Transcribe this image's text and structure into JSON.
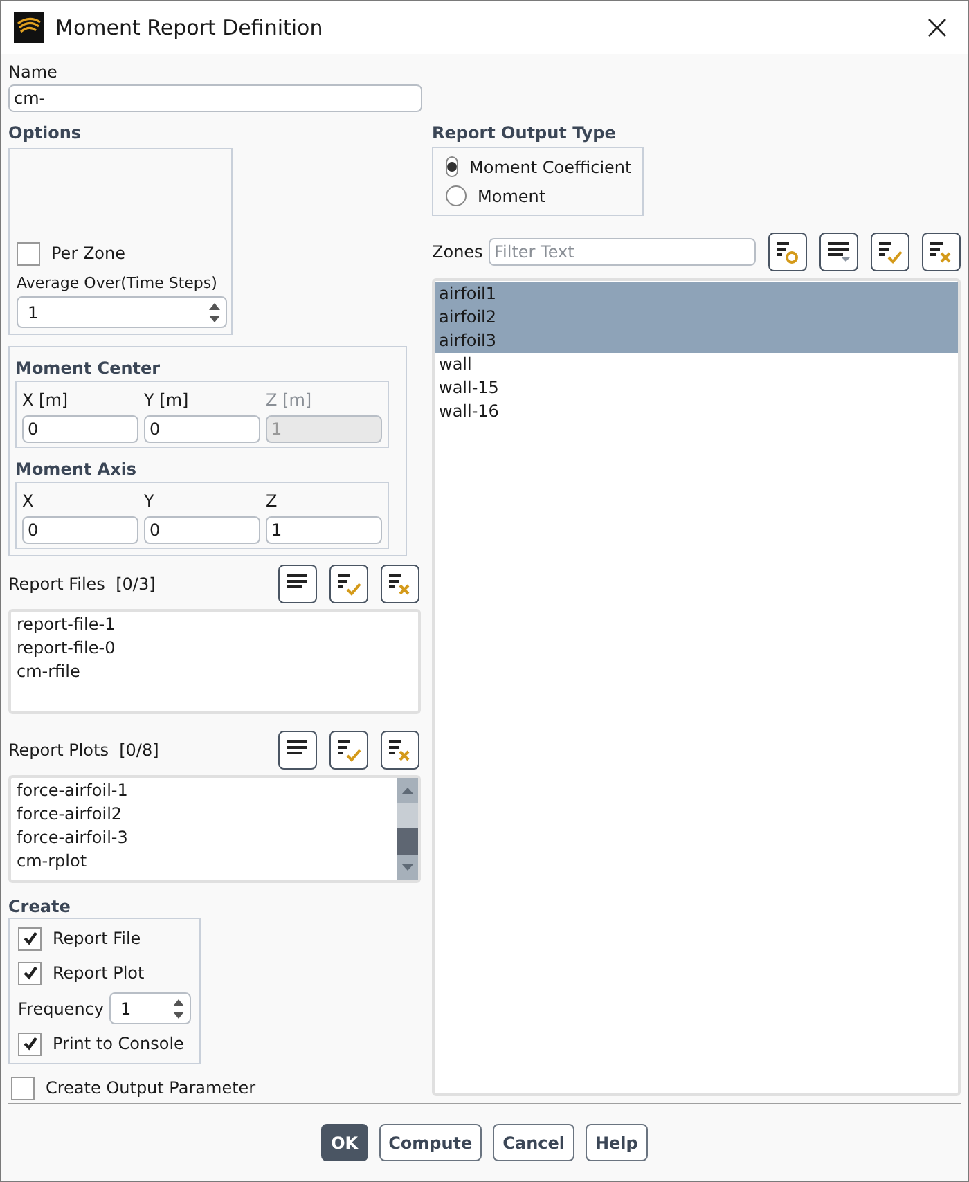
{
  "window": {
    "title": "Moment Report Definition"
  },
  "name": {
    "label": "Name",
    "value": "cm-"
  },
  "options": {
    "title": "Options",
    "per_zone": {
      "label": "Per Zone",
      "checked": false
    },
    "average_over": {
      "label": "Average Over(Time Steps)",
      "value": "1"
    }
  },
  "moment_center": {
    "title": "Moment Center",
    "fields": [
      {
        "label": "X [m]",
        "value": "0",
        "disabled": false
      },
      {
        "label": "Y [m]",
        "value": "0",
        "disabled": false
      },
      {
        "label": "Z [m]",
        "value": "1",
        "disabled": true
      }
    ]
  },
  "moment_axis": {
    "title": "Moment Axis",
    "fields": [
      {
        "label": "X",
        "value": "0",
        "disabled": false
      },
      {
        "label": "Y",
        "value": "0",
        "disabled": false
      },
      {
        "label": "Z",
        "value": "1",
        "disabled": false
      }
    ]
  },
  "report_files": {
    "label": "Report Files",
    "count": "[0/3]",
    "items": [
      "report-file-1",
      "report-file-0",
      "cm-rfile"
    ]
  },
  "report_plots": {
    "label": "Report Plots",
    "count": "[0/8]",
    "items": [
      "force-airfoil-1",
      "force-airfoil2",
      "force-airfoil-3",
      "cm-rplot"
    ]
  },
  "create": {
    "title": "Create",
    "items": [
      {
        "kind": "checkbox",
        "label": "Report File",
        "checked": true
      },
      {
        "kind": "checkbox",
        "label": "Report Plot",
        "checked": true
      },
      {
        "kind": "spinner",
        "label": "Frequency",
        "value": "1"
      },
      {
        "kind": "checkbox",
        "label": "Print to Console",
        "checked": true
      }
    ]
  },
  "create_output_parameter": {
    "label": "Create Output Parameter",
    "checked": false
  },
  "report_output_type": {
    "title": "Report Output Type",
    "options": [
      {
        "label": "Moment Coefficient",
        "selected": true
      },
      {
        "label": "Moment",
        "selected": false
      }
    ]
  },
  "zones": {
    "label": "Zones",
    "filter": {
      "placeholder": "Filter Text"
    },
    "items": [
      {
        "label": "airfoil1",
        "selected": true
      },
      {
        "label": "airfoil2",
        "selected": true
      },
      {
        "label": "airfoil3",
        "selected": true
      },
      {
        "label": "wall",
        "selected": false
      },
      {
        "label": "wall-15",
        "selected": false
      },
      {
        "label": "wall-16",
        "selected": false
      }
    ]
  },
  "buttons": [
    {
      "label": "OK",
      "default": true
    },
    {
      "label": "Compute",
      "default": false
    },
    {
      "label": "Cancel",
      "default": false
    },
    {
      "label": "Help",
      "default": false
    }
  ]
}
